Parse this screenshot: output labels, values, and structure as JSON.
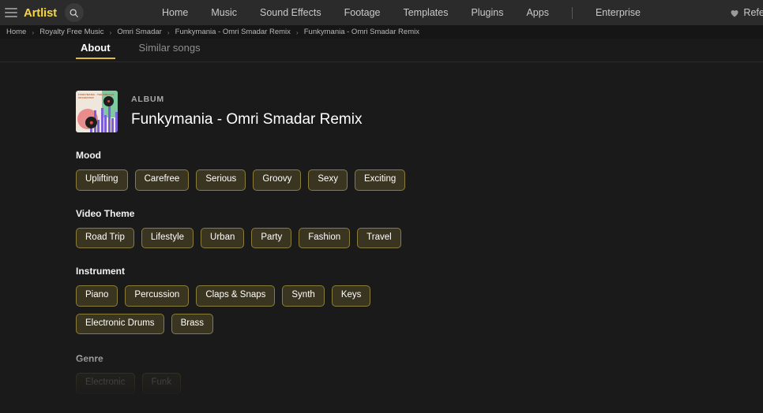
{
  "header": {
    "menu_icon": "hamburger-icon",
    "logo": "Artlist",
    "search_icon": "search-icon",
    "nav": [
      {
        "label": "Home"
      },
      {
        "label": "Music"
      },
      {
        "label": "Sound Effects"
      },
      {
        "label": "Footage"
      },
      {
        "label": "Templates"
      },
      {
        "label": "Plugins"
      },
      {
        "label": "Apps"
      },
      {
        "label": "Enterprise"
      }
    ],
    "refer": {
      "label": "Refer",
      "icon": "heart-icon"
    }
  },
  "breadcrumb": {
    "separator": "›",
    "items": [
      {
        "label": "Home"
      },
      {
        "label": "Royalty Free Music"
      },
      {
        "label": "Omri Smadar"
      },
      {
        "label": "Funkymania - Omri Smadar Remix"
      },
      {
        "label": "Funkymania - Omri Smadar Remix"
      }
    ]
  },
  "tabs": [
    {
      "label": "About",
      "active": true
    },
    {
      "label": "Similar songs",
      "active": false
    }
  ],
  "album": {
    "kicker": "ALBUM",
    "title": "Funkymania - Omri Smadar Remix",
    "artwork_caption": "FUNKYMANIA - THE OMRAAN ORCHESTER"
  },
  "sections": [
    {
      "title": "Mood",
      "tags": [
        "Uplifting",
        "Carefree",
        "Serious",
        "Groovy",
        "Sexy",
        "Exciting"
      ]
    },
    {
      "title": "Video Theme",
      "tags": [
        "Road Trip",
        "Lifestyle",
        "Urban",
        "Party",
        "Fashion",
        "Travel"
      ]
    },
    {
      "title": "Instrument",
      "tags": [
        "Piano",
        "Percussion",
        "Claps & Snaps",
        "Synth",
        "Keys",
        "Electronic Drums",
        "Brass"
      ]
    },
    {
      "title": "Genre",
      "tags": [
        "Electronic",
        "Funk"
      ]
    }
  ],
  "colors": {
    "accent": "#f5d547",
    "tab_underline": "#e2b93b",
    "tag_border": "#8a7d3a",
    "tag_background": "#3a3521",
    "page_background": "#1a1a1a",
    "topbar_background": "#2b2b2b"
  }
}
